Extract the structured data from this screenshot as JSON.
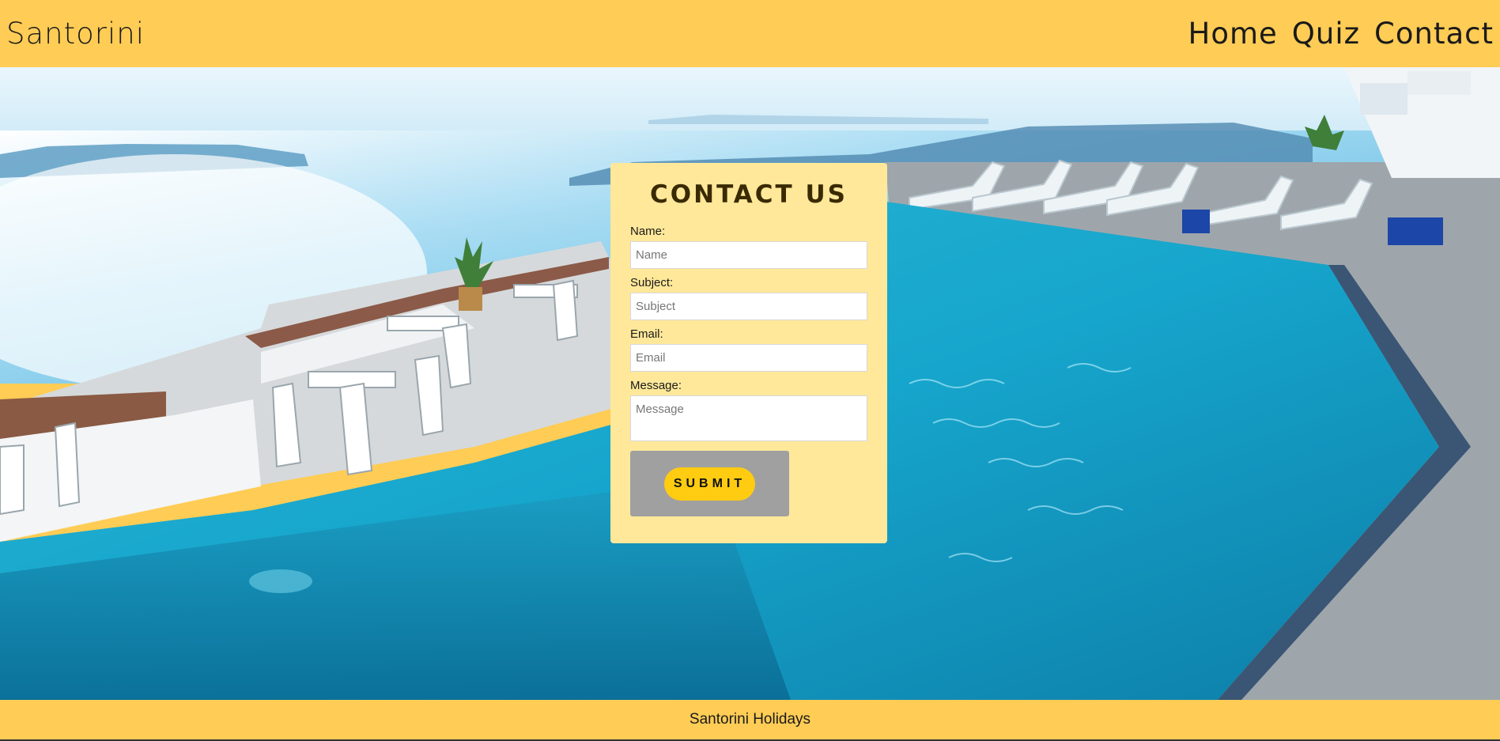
{
  "header": {
    "brand": "Santorini",
    "nav": [
      {
        "label": "Home"
      },
      {
        "label": "Quiz"
      },
      {
        "label": "Contact"
      }
    ]
  },
  "contact_form": {
    "title": "CONTACT US",
    "fields": {
      "name": {
        "label": "Name:",
        "placeholder": "Name",
        "value": ""
      },
      "subject": {
        "label": "Subject:",
        "placeholder": "Subject",
        "value": ""
      },
      "email": {
        "label": "Email:",
        "placeholder": "Email",
        "value": ""
      },
      "message": {
        "label": "Message:",
        "placeholder": "Message",
        "value": ""
      }
    },
    "submit_label": "SUBMIT"
  },
  "footer": {
    "text": "Santorini Holidays"
  },
  "colors": {
    "header_bg": "#ffcc55",
    "card_bg": "#ffe89a",
    "submit_bg": "#ffcc11",
    "submit_wrap_bg": "#a0a0a0"
  },
  "hero_image": {
    "icon": "santorini-pool-photo"
  }
}
